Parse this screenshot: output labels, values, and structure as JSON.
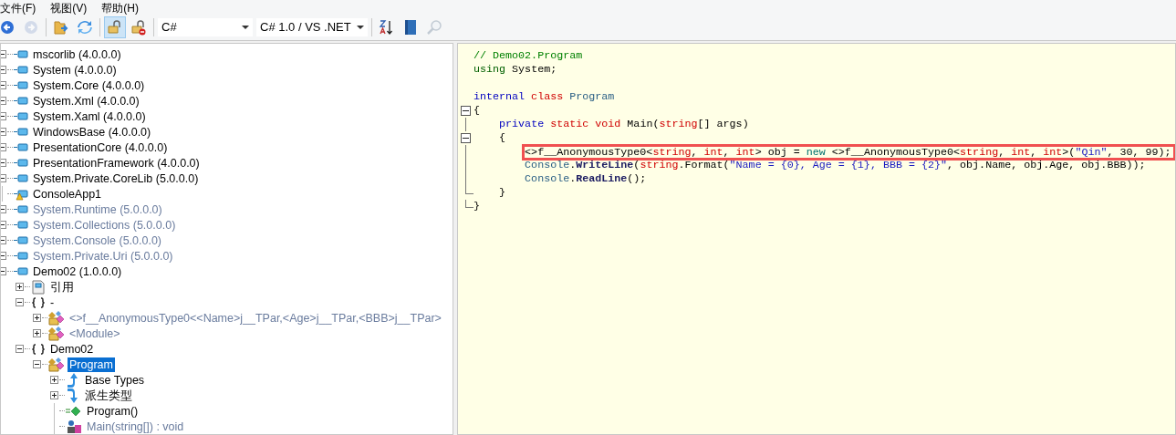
{
  "menu": [
    "文件(F)",
    "视图(V)",
    "帮助(H)"
  ],
  "toolbar": [
    {
      "kind": "back",
      "disabled": false,
      "pressed": false
    },
    {
      "kind": "forward",
      "disabled": true,
      "pressed": false
    },
    {
      "kind": "separator"
    },
    {
      "kind": "open",
      "disabled": false,
      "pressed": false
    },
    {
      "kind": "refresh",
      "disabled": false,
      "pressed": false
    },
    {
      "kind": "separator"
    },
    {
      "kind": "lock",
      "disabled": false,
      "pressed": true
    },
    {
      "kind": "lock-remove",
      "disabled": false,
      "pressed": false
    },
    {
      "kind": "separator"
    },
    {
      "kind": "combo",
      "value": "C#"
    },
    {
      "kind": "combo",
      "value": "C# 1.0 / VS .NET"
    },
    {
      "kind": "separator"
    },
    {
      "kind": "sort",
      "disabled": false,
      "pressed": false
    },
    {
      "kind": "book",
      "disabled": false,
      "pressed": false
    },
    {
      "kind": "search",
      "disabled": true,
      "pressed": false
    }
  ],
  "tree": [
    {
      "label": "mscorlib (4.0.0.0)",
      "kind": "assembly",
      "expanded": true,
      "dimmed": false,
      "selected": false
    },
    {
      "label": "System (4.0.0.0)",
      "kind": "assembly",
      "expanded": true,
      "dimmed": false,
      "selected": false
    },
    {
      "label": "System.Core (4.0.0.0)",
      "kind": "assembly",
      "expanded": true,
      "dimmed": false,
      "selected": false
    },
    {
      "label": "System.Xml (4.0.0.0)",
      "kind": "assembly",
      "expanded": true,
      "dimmed": false,
      "selected": false
    },
    {
      "label": "System.Xaml (4.0.0.0)",
      "kind": "assembly",
      "expanded": true,
      "dimmed": false,
      "selected": false
    },
    {
      "label": "WindowsBase (4.0.0.0)",
      "kind": "assembly",
      "expanded": true,
      "dimmed": false,
      "selected": false
    },
    {
      "label": "PresentationCore (4.0.0.0)",
      "kind": "assembly",
      "expanded": true,
      "dimmed": false,
      "selected": false
    },
    {
      "label": "PresentationFramework (4.0.0.0)",
      "kind": "assembly",
      "expanded": true,
      "dimmed": false,
      "selected": false
    },
    {
      "label": "System.Private.CoreLib (5.0.0.0)",
      "kind": "assembly",
      "expanded": true,
      "dimmed": false,
      "selected": false
    },
    {
      "label": "ConsoleApp1",
      "kind": "warning",
      "dimmed": false,
      "selected": false
    },
    {
      "label": "System.Runtime (5.0.0.0)",
      "kind": "assembly",
      "expanded": true,
      "dimmed": true,
      "selected": false
    },
    {
      "label": "System.Collections (5.0.0.0)",
      "kind": "assembly",
      "expanded": true,
      "dimmed": true,
      "selected": false
    },
    {
      "label": "System.Console (5.0.0.0)",
      "kind": "assembly",
      "expanded": true,
      "dimmed": true,
      "selected": false
    },
    {
      "label": "System.Private.Uri (5.0.0.0)",
      "kind": "assembly",
      "expanded": true,
      "dimmed": true,
      "selected": false
    },
    {
      "label": "Demo02 (1.0.0.0)",
      "kind": "assembly",
      "expanded": true,
      "dimmed": false,
      "selected": false,
      "children": [
        {
          "label": "引用",
          "kind": "reference",
          "expanded": false,
          "dimmed": false,
          "selected": false
        },
        {
          "label": "-",
          "kind": "namespace",
          "expanded": true,
          "dimmed": false,
          "selected": false,
          "children": [
            {
              "label": "<>f__AnonymousType0<<Name>j__TPar,<Age>j__TPar,<BBB>j__TPar>",
              "kind": "class",
              "expanded": false,
              "dimmed": true,
              "selected": false
            },
            {
              "label": "<Module>",
              "kind": "class",
              "expanded": false,
              "dimmed": true,
              "selected": false
            }
          ]
        },
        {
          "label": "Demo02",
          "kind": "namespace",
          "expanded": true,
          "dimmed": false,
          "selected": false,
          "children": [
            {
              "label": "Program",
              "kind": "class",
              "expanded": true,
              "dimmed": false,
              "selected": true,
              "children": [
                {
                  "label": "Base Types",
                  "kind": "base",
                  "expanded": false,
                  "dimmed": false,
                  "selected": false
                },
                {
                  "label": "派生类型",
                  "kind": "derived",
                  "expanded": false,
                  "dimmed": false,
                  "selected": false
                },
                {
                  "label": "Program()",
                  "kind": "constructor",
                  "dimmed": false,
                  "selected": false
                },
                {
                  "label": "Main(string[]) : void",
                  "kind": "method",
                  "dimmed": true,
                  "selected": false
                }
              ]
            }
          ]
        }
      ]
    }
  ],
  "code": [
    {
      "kind": "plain",
      "tokens": [
        {
          "text": "// Demo02.Program",
          "kind": "comment"
        }
      ]
    },
    {
      "kind": "plain",
      "tokens": [
        {
          "text": "using",
          "kind": "directive"
        },
        {
          "text": " System;",
          "kind": "plain"
        }
      ]
    },
    {
      "kind": "plain"
    },
    {
      "kind": "plain",
      "tokens": [
        {
          "text": "internal",
          "kind": "keyword"
        },
        {
          "text": " class",
          "kind": "keyword2"
        },
        {
          "text": " Program",
          "kind": "type"
        }
      ]
    },
    {
      "kind": "fold-start",
      "tokens": [
        {
          "text": "{",
          "kind": "plain"
        }
      ]
    },
    {
      "kind": "fold-inner",
      "tokens": [
        {
          "text": "    private",
          "kind": "keyword"
        },
        {
          "text": " static void",
          "kind": "keyword2"
        },
        {
          "text": " Main(",
          "kind": "plain"
        },
        {
          "text": "string",
          "kind": "keyword2"
        },
        {
          "text": "[] args)",
          "kind": "plain"
        }
      ]
    },
    {
      "kind": "fold-start",
      "tokens": [
        {
          "text": "    {",
          "kind": "plain"
        }
      ]
    },
    {
      "kind": "fold-inner",
      "highlighted": true,
      "tokens": [
        {
          "text": "        <>f__AnonymousType0<",
          "kind": "plain"
        },
        {
          "text": "string",
          "kind": "keyword2"
        },
        {
          "text": ", ",
          "kind": "plain"
        },
        {
          "text": "int",
          "kind": "keyword2"
        },
        {
          "text": ", ",
          "kind": "plain"
        },
        {
          "text": "int",
          "kind": "keyword2"
        },
        {
          "text": "> obj = ",
          "kind": "plain"
        },
        {
          "text": "new",
          "kind": "new"
        },
        {
          "text": " <>f__AnonymousType0<",
          "kind": "plain"
        },
        {
          "text": "string",
          "kind": "keyword2"
        },
        {
          "text": ", ",
          "kind": "plain"
        },
        {
          "text": "int",
          "kind": "keyword2"
        },
        {
          "text": ", ",
          "kind": "plain"
        },
        {
          "text": "int",
          "kind": "keyword2"
        },
        {
          "text": ">(",
          "kind": "plain"
        },
        {
          "text": "\"Qin\"",
          "kind": "string"
        },
        {
          "text": ", 30, 99);",
          "kind": "plain"
        }
      ]
    },
    {
      "kind": "fold-inner",
      "tokens": [
        {
          "text": "        Console",
          "kind": "type"
        },
        {
          "text": ".",
          "kind": "plain"
        },
        {
          "text": "WriteLine",
          "kind": "method"
        },
        {
          "text": "(",
          "kind": "plain"
        },
        {
          "text": "string",
          "kind": "keyword2"
        },
        {
          "text": ".Format(",
          "kind": "plain"
        },
        {
          "text": "\"Name = {0}, Age = {1}, BBB = {2}\"",
          "kind": "string"
        },
        {
          "text": ", obj.Name, obj.Age, obj.BBB));",
          "kind": "plain"
        }
      ]
    },
    {
      "kind": "fold-inner",
      "tokens": [
        {
          "text": "        Console",
          "kind": "type"
        },
        {
          "text": ".",
          "kind": "plain"
        },
        {
          "text": "ReadLine",
          "kind": "method"
        },
        {
          "text": "();",
          "kind": "plain"
        }
      ]
    },
    {
      "kind": "fold-tick",
      "tokens": [
        {
          "text": "    }",
          "kind": "plain"
        }
      ]
    },
    {
      "kind": "fold-end",
      "tokens": [
        {
          "text": "}",
          "kind": "plain"
        }
      ]
    }
  ]
}
